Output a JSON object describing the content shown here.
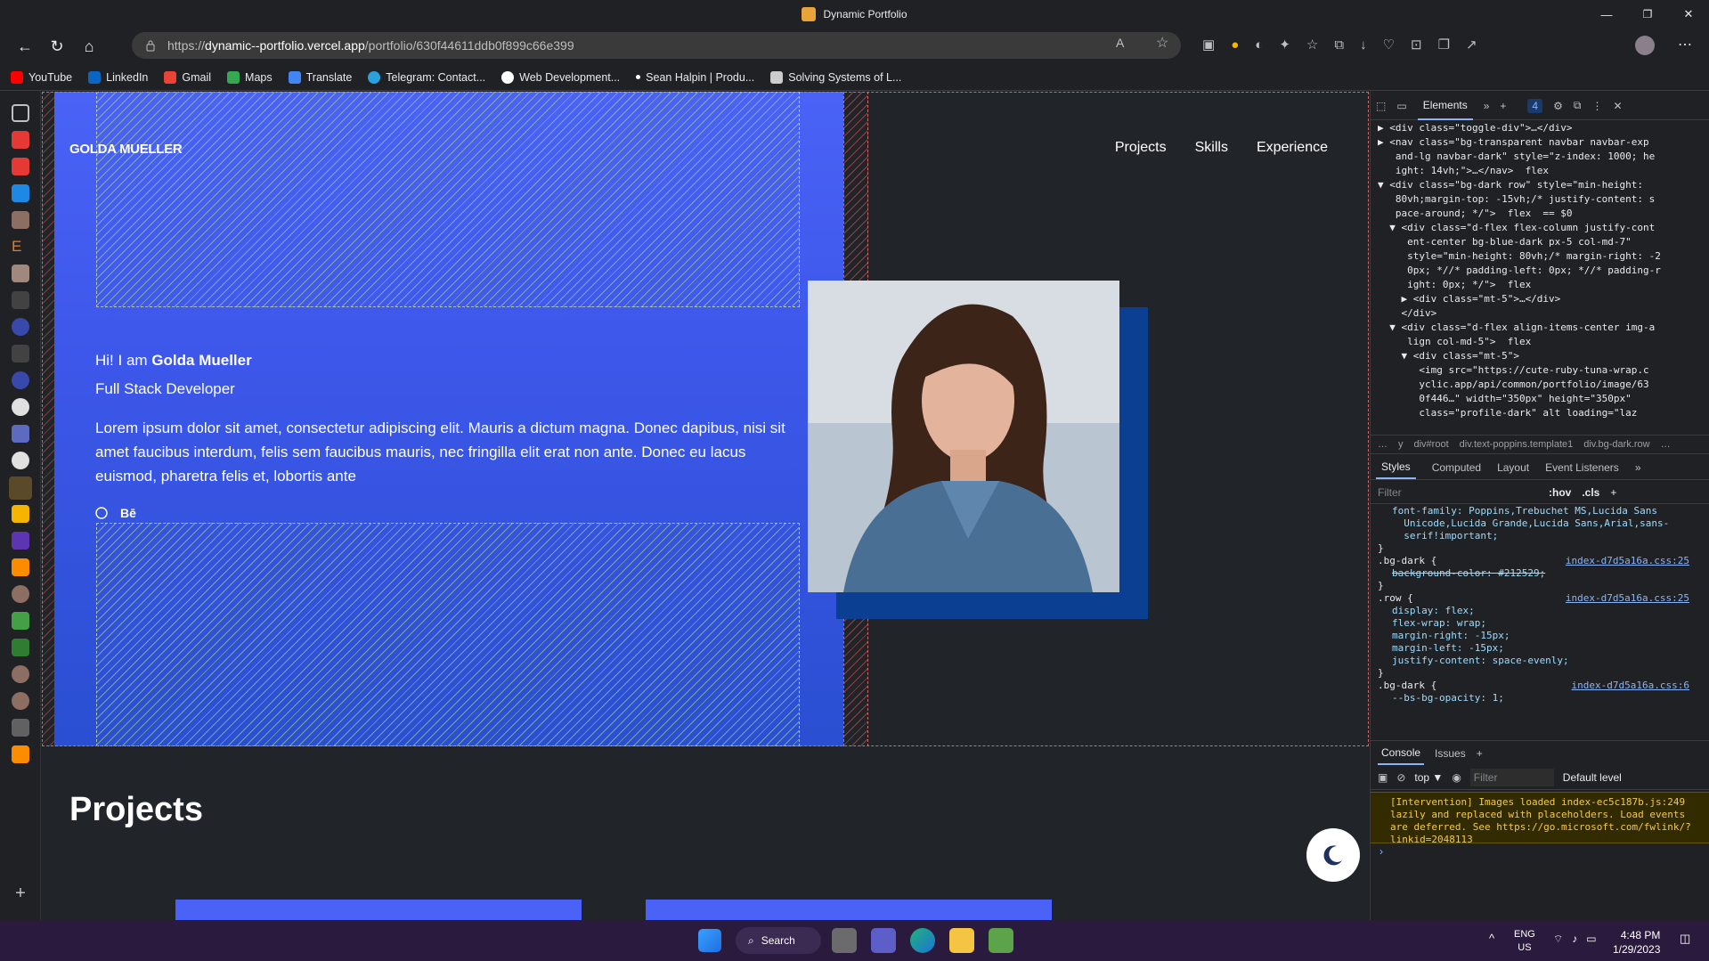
{
  "window": {
    "title": "Dynamic Portfolio",
    "minimize": "—",
    "maximize": "❐",
    "close": "✕"
  },
  "browser": {
    "url_prefix": "https://",
    "url_host": "dynamic--portfolio.vercel.app",
    "url_path": "/portfolio/630f44611ddb0f899c66e399",
    "bookmarks": [
      {
        "label": "YouTube",
        "color": "#ff0000"
      },
      {
        "label": "LinkedIn",
        "color": "#0a66c2"
      },
      {
        "label": "Gmail",
        "color": "#ea4335"
      },
      {
        "label": "Maps",
        "color": "#34a853"
      },
      {
        "label": "Translate",
        "color": "#4285f4"
      },
      {
        "label": "Telegram: Contact...",
        "color": "#2aa1dc"
      },
      {
        "label": "Web Development...",
        "color": "#ffffff"
      },
      {
        "label": "Sean Halpin | Produ...",
        "color": "#ffffff"
      },
      {
        "label": "Solving Systems of L...",
        "color": "#cccccc"
      }
    ]
  },
  "portfolio": {
    "brand": "GOLDA MUELLER",
    "nav": [
      "Projects",
      "Skills",
      "Experience"
    ],
    "greeting_prefix": "Hi! I am ",
    "name": "Golda Mueller",
    "role": "Full Stack Developer",
    "bio": "Lorem ipsum dolor sit amet, consectetur adipiscing elit. Mauris a dictum magna. Donec dapibus, nisi sit amet faucibus interdum, felis sem faucibus mauris, nec fringilla elit erat non ante. Donec eu lacus euismod, pharetra felis et, lobortis ante",
    "social_behance": "Bē",
    "projects_heading": "Projects",
    "accent": "#4a63f6"
  },
  "devtools": {
    "tabs": [
      "Elements",
      "»",
      "+"
    ],
    "issues_count": "4",
    "dom_lines": [
      "▶ <div class=\"toggle-div\">…</div>",
      "▶ <nav class=\"bg-transparent navbar navbar-exp",
      "   and-lg navbar-dark\" style=\"z-index: 1000; he",
      "   ight: 14vh;\">…</nav>  flex",
      "▼ <div class=\"bg-dark row\" style=\"min-height:",
      "   80vh;margin-top: -15vh;/* justify-content: s",
      "   pace-around; */\">  flex  == $0",
      "  ▼ <div class=\"d-flex flex-column justify-cont",
      "     ent-center bg-blue-dark px-5 col-md-7\"",
      "     style=\"min-height: 80vh;/* margin-right: -2",
      "     0px; *//* padding-left: 0px; *//* padding-r",
      "     ight: 0px; */\">  flex",
      "    ▶ <div class=\"mt-5\">…</div>",
      "    </div>",
      "  ▼ <div class=\"d-flex align-items-center img-a",
      "     lign col-md-5\">  flex",
      "    ▼ <div class=\"mt-5\">",
      "       <img src=\"https://cute-ruby-tuna-wrap.c",
      "       yclic.app/api/common/portfolio/image/63",
      "       0f446…\" width=\"350px\" height=\"350px\"",
      "       class=\"profile-dark\" alt loading=\"laz"
    ],
    "breadcrumbs": [
      "…",
      "y",
      "div#root",
      "div.text-poppins.template1",
      "div.bg-dark.row",
      "…"
    ],
    "style_tabs": [
      "Styles",
      "Computed",
      "Layout",
      "Event Listeners",
      "»"
    ],
    "filter_placeholder": "Filter",
    "hov": ":hov",
    "cls": ".cls",
    "css_lines": [
      {
        "text": "font-family: Poppins,Trebuchet MS,Lucida Sans",
        "cls": "prop"
      },
      {
        "text": "  Unicode,Lucida Grande,Lucida Sans,Arial,sans-",
        "cls": "prop"
      },
      {
        "text": "  serif!important;",
        "cls": "prop"
      },
      {
        "text": "}",
        "cls": ""
      },
      {
        "text": ".bg-dark {",
        "cls": "",
        "src": "index-d7d5a16a.css:25"
      },
      {
        "text": "background-color: #212529;",
        "cls": "prop strike"
      },
      {
        "text": "}",
        "cls": ""
      },
      {
        "text": ".row {",
        "cls": "",
        "src": "index-d7d5a16a.css:25"
      },
      {
        "text": "display: flex;",
        "cls": "prop"
      },
      {
        "text": "flex-wrap: wrap;",
        "cls": "prop"
      },
      {
        "text": "margin-right: -15px;",
        "cls": "prop"
      },
      {
        "text": "margin-left: -15px;",
        "cls": "prop"
      },
      {
        "text": "justify-content: space-evenly;",
        "cls": "prop"
      },
      {
        "text": "}",
        "cls": ""
      },
      {
        "text": ".bg-dark {",
        "cls": "",
        "src": "index-d7d5a16a.css:6"
      },
      {
        "text": "--bs-bg-opacity: 1;",
        "cls": "prop"
      }
    ],
    "console_tabs": [
      "Console",
      "Issues",
      "+"
    ],
    "console_context": "top ▼",
    "console_filter": "Filter",
    "console_level": "Default level",
    "console_message": "[Intervention] Images loaded index-ec5c187b.js:249 lazily and replaced with placeholders. Load events are deferred. See https://go.microsoft.com/fwlink/?linkid=2048113",
    "console_prompt": "›"
  },
  "taskbar": {
    "search_label": "Search",
    "lang": "ENG",
    "region": "US",
    "time": "4:48 PM",
    "date": "1/29/2023"
  }
}
